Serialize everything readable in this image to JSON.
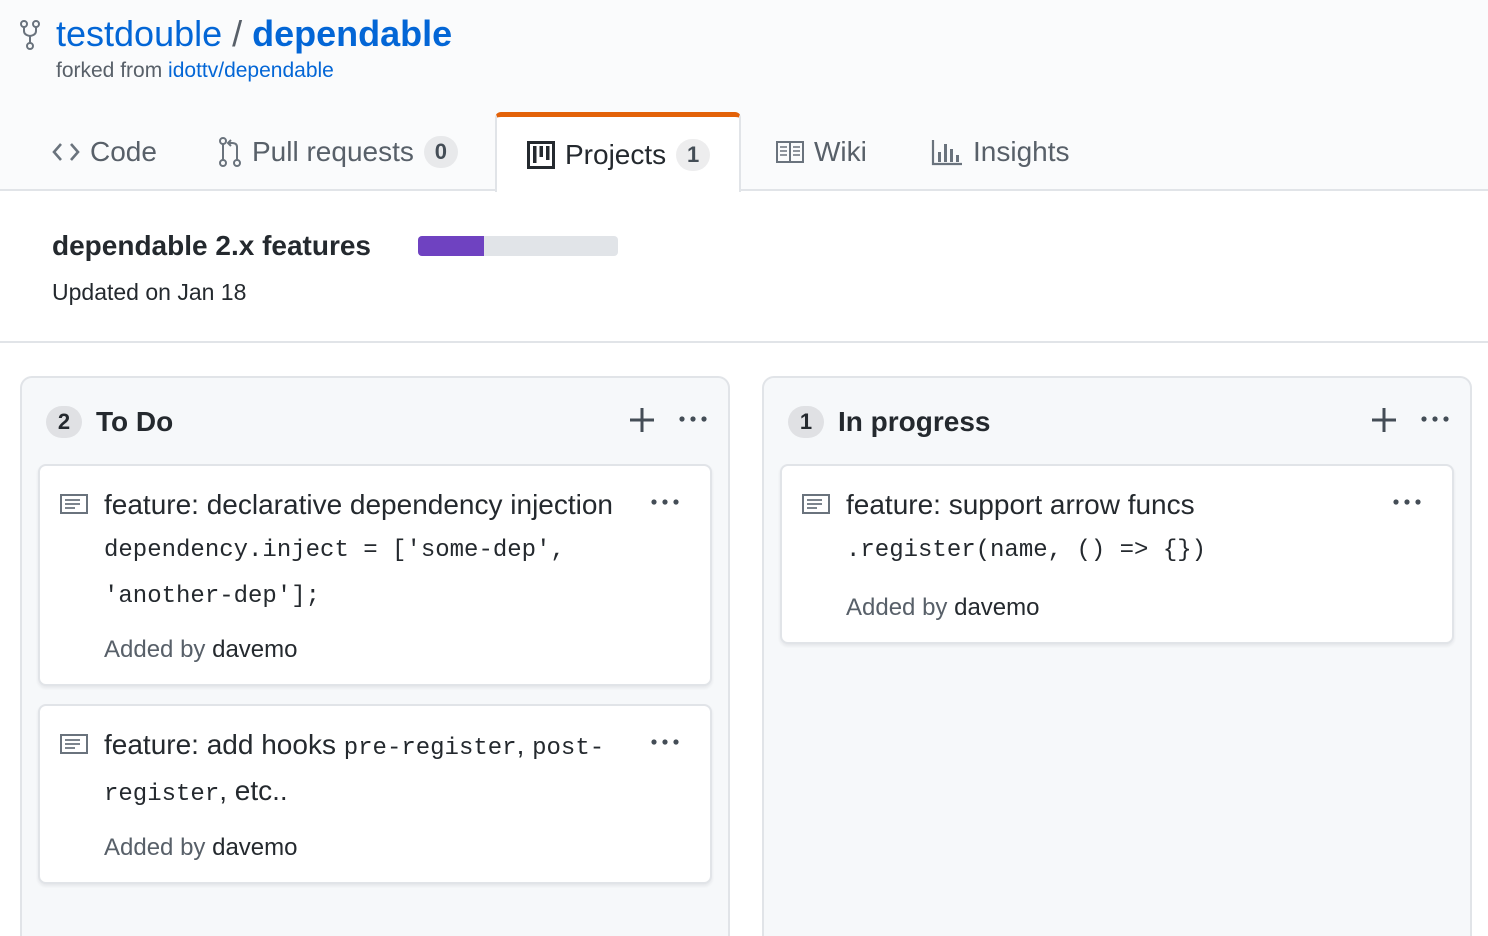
{
  "repo": {
    "owner": "testdouble",
    "separator": "/",
    "name": "dependable",
    "forked_prefix": "forked from",
    "forked_source": "idottv/dependable"
  },
  "tabs": [
    {
      "label": "Code",
      "icon": "code-icon"
    },
    {
      "label": "Pull requests",
      "icon": "git-pull-request-icon",
      "count": "0"
    },
    {
      "label": "Projects",
      "icon": "project-icon",
      "count": "1",
      "selected": true
    },
    {
      "label": "Wiki",
      "icon": "book-icon"
    },
    {
      "label": "Insights",
      "icon": "graph-icon"
    }
  ],
  "project": {
    "title": "dependable 2.x features",
    "updated": "Updated on Jan 18",
    "progress_fraction": 0.33,
    "progress_color": "#6f42c1"
  },
  "columns": [
    {
      "count": "2",
      "name": "To Do",
      "cards": [
        {
          "text": "feature: declarative dependency injection",
          "code": "dependency.inject = ['some-dep', 'another-dep'];",
          "added_by_label": "Added by",
          "author": "davemo"
        },
        {
          "text_before": "feature: add hooks ",
          "code_a": "pre-register",
          "text_mid": ", ",
          "code_b": "post-register",
          "text_after": ", etc..",
          "added_by_label": "Added by",
          "author": "davemo"
        }
      ]
    },
    {
      "count": "1",
      "name": "In progress",
      "cards": [
        {
          "text": "feature: support arrow funcs",
          "code": ".register(name, () => {})",
          "added_by_label": "Added by",
          "author": "davemo"
        }
      ]
    }
  ],
  "colors": {
    "link": "#0366d6",
    "selected_tab_accent": "#e36209",
    "muted_text": "#586069"
  }
}
